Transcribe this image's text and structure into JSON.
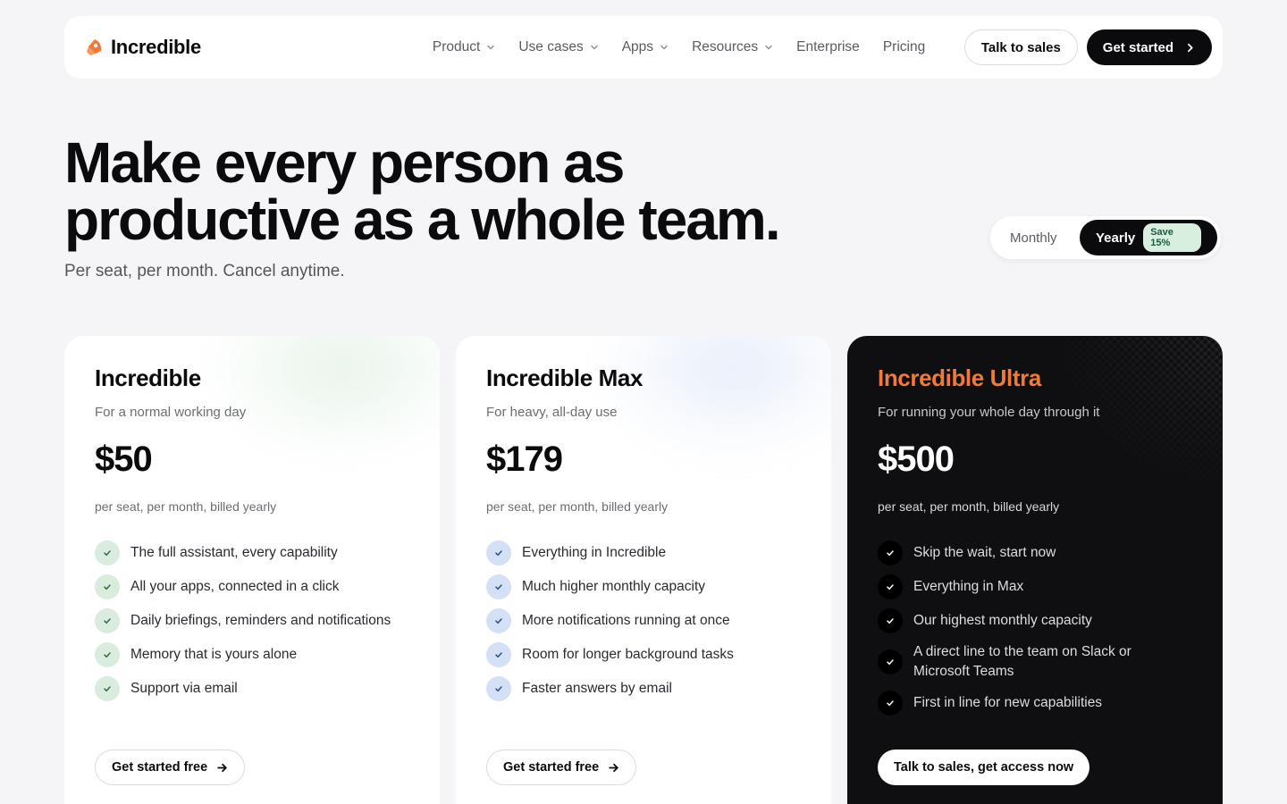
{
  "nav": {
    "brand": "Incredible",
    "links": [
      {
        "label": "Product",
        "dropdown": true
      },
      {
        "label": "Use cases",
        "dropdown": true
      },
      {
        "label": "Apps",
        "dropdown": true
      },
      {
        "label": "Resources",
        "dropdown": true
      },
      {
        "label": "Enterprise",
        "dropdown": false
      },
      {
        "label": "Pricing",
        "dropdown": false
      }
    ],
    "talk_to_sales": "Talk to sales",
    "get_started": "Get started"
  },
  "hero": {
    "title_line1": "Make every person as",
    "title_line2": "productive as a whole team.",
    "subtitle": "Per seat, per month. Cancel anytime."
  },
  "billing_toggle": {
    "monthly": "Monthly",
    "yearly": "Yearly",
    "save_badge": "Save 15%",
    "selected": "yearly"
  },
  "plans": [
    {
      "name": "Incredible",
      "description": "For a normal working day",
      "price": "$50",
      "billing": "per seat, per month, billed yearly",
      "features": [
        "The full assistant, every capability",
        "All your apps, connected in a click",
        "Daily briefings, reminders and notifications",
        "Memory that is yours alone",
        "Support via email"
      ],
      "cta": "Get started free"
    },
    {
      "name": "Incredible Max",
      "description": "For heavy, all-day use",
      "price": "$179",
      "billing": "per seat, per month, billed yearly",
      "features": [
        "Everything in Incredible",
        "Much higher monthly capacity",
        "More notifications running at once",
        "Room for longer background tasks",
        "Faster answers by email"
      ],
      "cta": "Get started free"
    },
    {
      "name": "Incredible Ultra",
      "description": "For running your whole day through it",
      "price": "$500",
      "billing": "per seat, per month, billed yearly",
      "features": [
        "Skip the wait, start now",
        "Everything in Max",
        "Our highest monthly capacity",
        "A direct line to the team on Slack or Microsoft Teams",
        "First in line for new capabilities"
      ],
      "cta": "Talk to sales, get access now"
    }
  ],
  "colors": {
    "accent_orange": "#f07a3a",
    "dark": "#0b0b0d",
    "background": "#f5f5f7"
  },
  "icons": {
    "logo": "rocket-logo-icon",
    "dropdown": "chevron-down-icon",
    "nav_cta": "chevron-right-icon",
    "feature": "check-icon",
    "card_cta": "arrow-right-icon"
  }
}
